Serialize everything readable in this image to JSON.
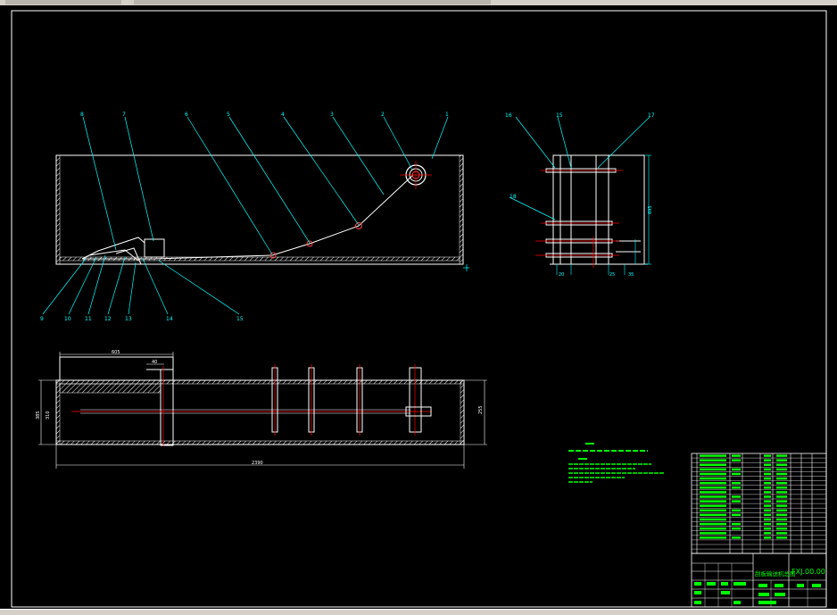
{
  "drawing": {
    "callouts_side": [
      "8",
      "7",
      "6",
      "5",
      "4",
      "3",
      "2",
      "1"
    ],
    "callouts_bottom": [
      "9",
      "10",
      "11",
      "12",
      "13",
      "14",
      "15"
    ],
    "callouts_end": [
      "16",
      "15",
      "17",
      "18"
    ],
    "dims_end": [
      "695",
      "20",
      "25",
      "35"
    ],
    "dims_top": [
      "605",
      "40",
      "2390",
      "385",
      "310"
    ],
    "dim_side_right": "255"
  },
  "title_block": {
    "drawing_title": "刮板输送机总图",
    "drawing_number": "FXJ.00.00"
  },
  "colors": {
    "outline": "#ffffff",
    "dimension": "#00ffff",
    "centerline": "#ff0000",
    "notes": "#00ff00"
  }
}
